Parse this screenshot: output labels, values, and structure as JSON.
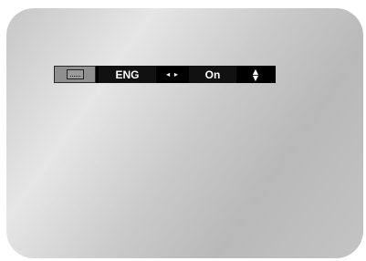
{
  "osd": {
    "subtitle_icon": "subtitle-icon",
    "language": "ENG",
    "left_right_hint": "◂ ▸",
    "state": "On",
    "up_down_hint_up": "▲",
    "up_down_hint_down": "▼"
  }
}
